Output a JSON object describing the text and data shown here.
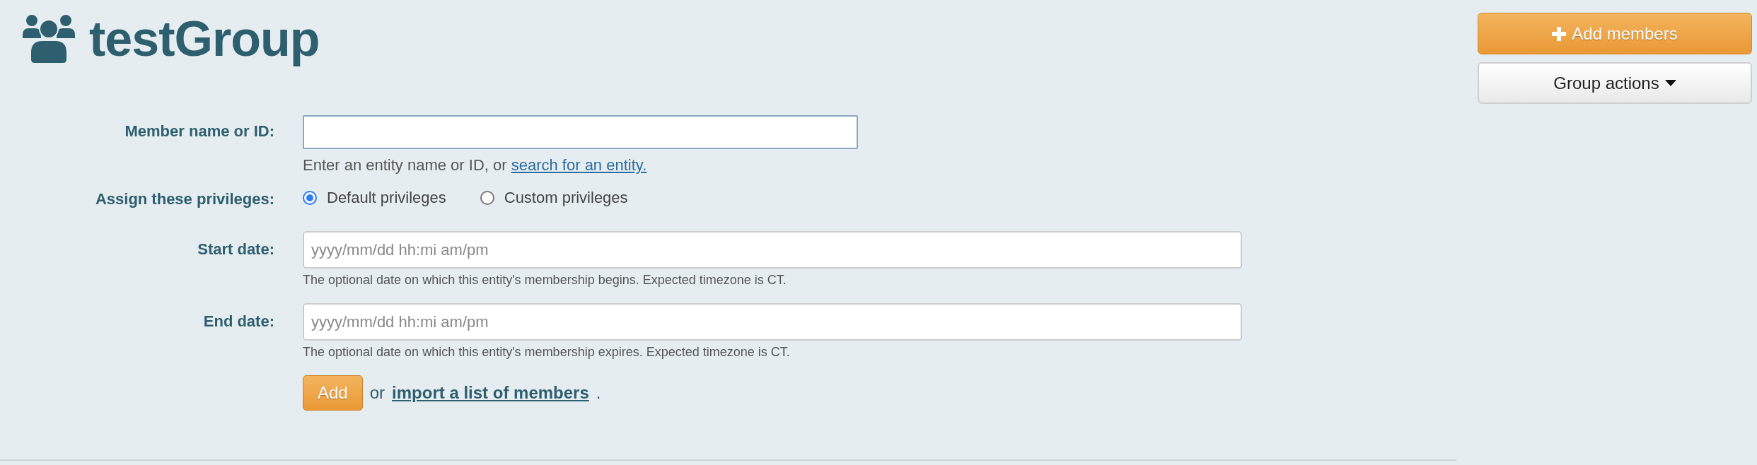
{
  "header": {
    "title": "testGroup"
  },
  "actions": [
    {
      "kind": "primary",
      "label": "Add members"
    },
    {
      "kind": "dropdown",
      "label": "Group actions"
    }
  ],
  "form": {
    "member": {
      "label": "Member name or ID:",
      "focused": true,
      "hint": "Enter an entity name or ID, or ",
      "hint_link": "search for an entity."
    },
    "privileges": {
      "label": "Assign these privileges:",
      "options": [
        {
          "label": "Default privileges",
          "selected": true
        },
        {
          "label": "Custom privileges",
          "selected": false
        }
      ]
    },
    "dates": [
      {
        "label": "Start date:",
        "placeholder": "yyyy/mm/dd hh:mi am/pm",
        "hint": "The optional date on which this entity's membership begins. Expected timezone is CT."
      },
      {
        "label": "End date:",
        "placeholder": "yyyy/mm/dd hh:mi am/pm",
        "hint": "The optional date on which this entity's membership expires. Expected timezone is CT."
      }
    ],
    "submit": {
      "button": "Add",
      "connector": "or",
      "link": "import a list of members",
      "end": "."
    }
  }
}
